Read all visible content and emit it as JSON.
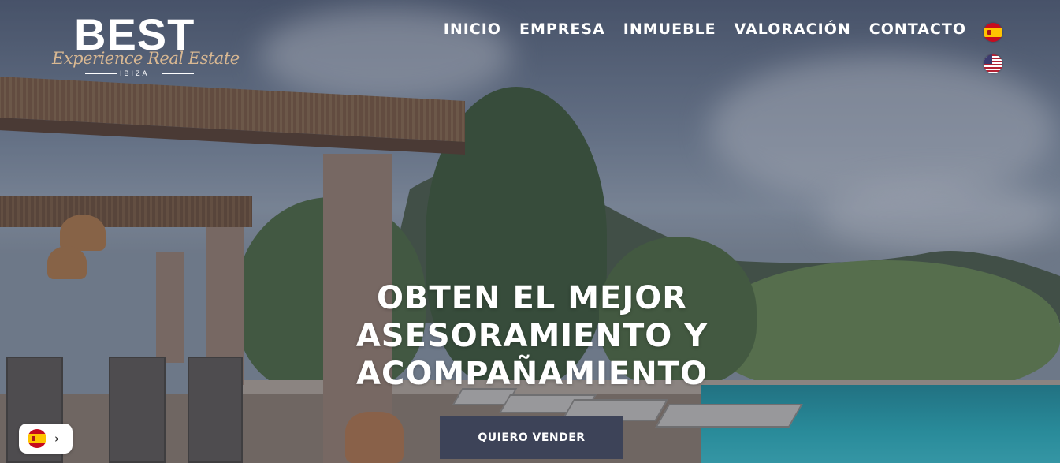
{
  "logo": {
    "main": "BEST",
    "script": "Experience Real Estate",
    "location": "IBIZA"
  },
  "nav": {
    "items": [
      {
        "label": "INICIO"
      },
      {
        "label": "EMPRESA"
      },
      {
        "label": "INMUEBLE"
      },
      {
        "label": "VALORACIÓN"
      },
      {
        "label": "CONTACTO"
      }
    ]
  },
  "languages": {
    "options": [
      "spain-flag-icon",
      "usa-flag-icon"
    ],
    "current": "spain-flag-icon",
    "switcher_arrow": "›"
  },
  "hero": {
    "headline_lines": [
      "OBTEN EL MEJOR",
      "ASESORAMIENTO Y",
      "ACOMPAÑAMIENTO"
    ],
    "cta_label": "QUIERO VENDER"
  },
  "colors": {
    "overlay": "#283042",
    "cta_bg": "#3d4358",
    "logo_accent": "#d9b892",
    "text": "#ffffff"
  }
}
